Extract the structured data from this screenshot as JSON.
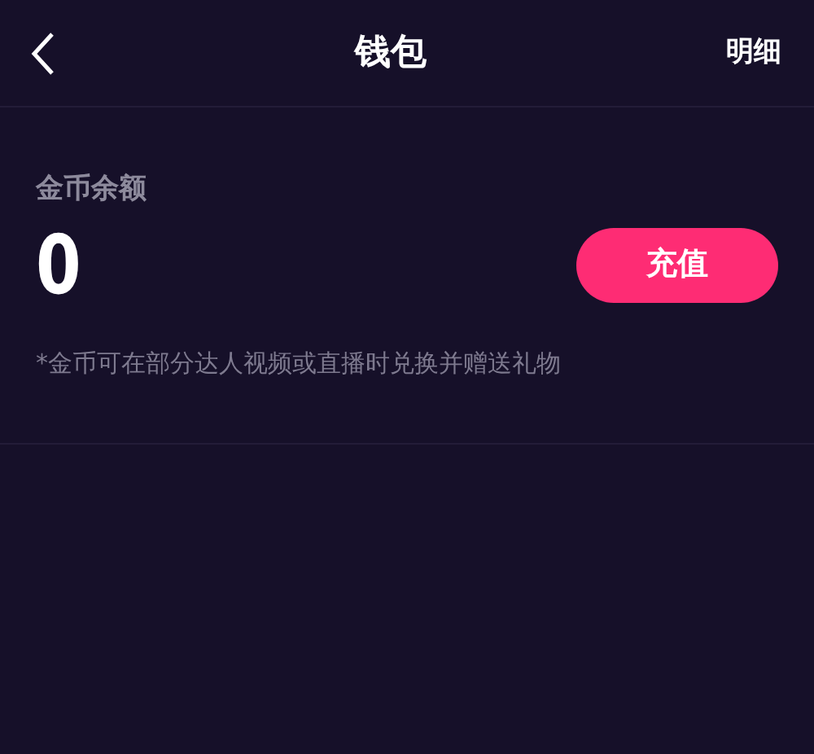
{
  "header": {
    "title": "钱包",
    "action": "明细"
  },
  "balance": {
    "label": "金币余额",
    "amount": "0",
    "button": "充值"
  },
  "note": "*金币可在部分达人视频或直播时兑换并赠送礼物"
}
